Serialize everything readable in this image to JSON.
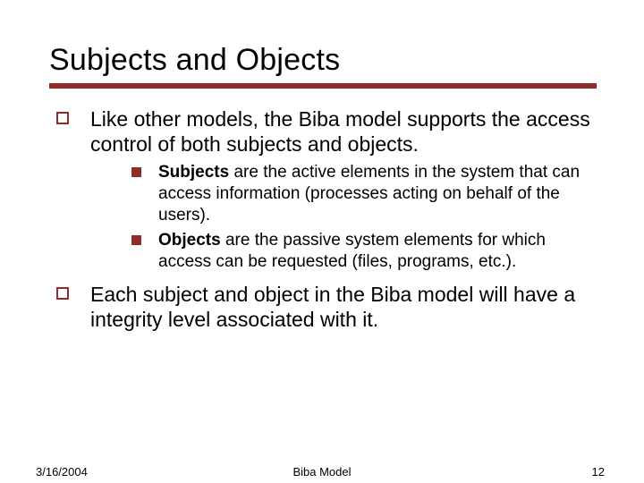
{
  "title": "Subjects and Objects",
  "bullets": {
    "b1": "Like other models, the Biba model supports the access control of both subjects and objects.",
    "sub1_bold": "Subjects",
    "sub1_rest": " are the active elements in the system that can access information (processes acting on behalf of the users).",
    "sub2_bold": "Objects",
    "sub2_rest": " are the passive system elements for which access can be requested (files, programs, etc.).",
    "b2": "Each subject and object in the Biba model will have a integrity level associated with it."
  },
  "footer": {
    "date": "3/16/2004",
    "center": "Biba Model",
    "page": "12"
  },
  "accent_color": "#8f2c2c"
}
